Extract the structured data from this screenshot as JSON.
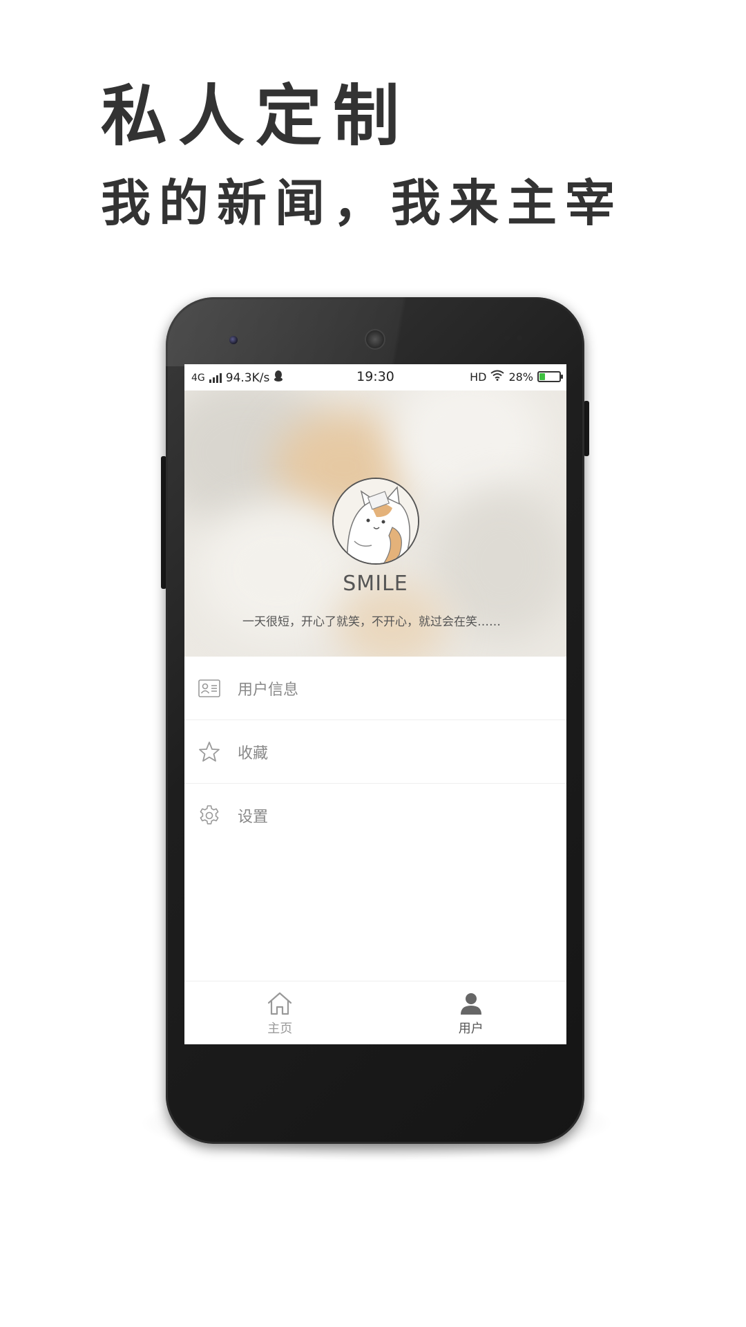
{
  "headline": {
    "line1": "私人定制",
    "line2": "我的新闻，我来主宰"
  },
  "status_bar": {
    "network": "4G",
    "speed": "94.3K/s",
    "time": "19:30",
    "hd": "HD",
    "battery_text": "28%",
    "battery_level": 0.28
  },
  "profile": {
    "name": "SMILE",
    "bio": "一天很短，开心了就笑，不开心，就过会在笑……"
  },
  "menu": {
    "items": [
      {
        "label": "用户信息",
        "icon": "id-card-icon"
      },
      {
        "label": "收藏",
        "icon": "star-icon"
      },
      {
        "label": "设置",
        "icon": "gear-icon"
      }
    ]
  },
  "bottom_nav": {
    "items": [
      {
        "label": "主页",
        "icon": "home-icon",
        "active": false
      },
      {
        "label": "用户",
        "icon": "user-icon",
        "active": true
      }
    ]
  },
  "colors": {
    "active_nav": "#555555",
    "inactive_nav": "#999999",
    "menu_text": "#888888",
    "battery_fill": "#3ec040"
  }
}
